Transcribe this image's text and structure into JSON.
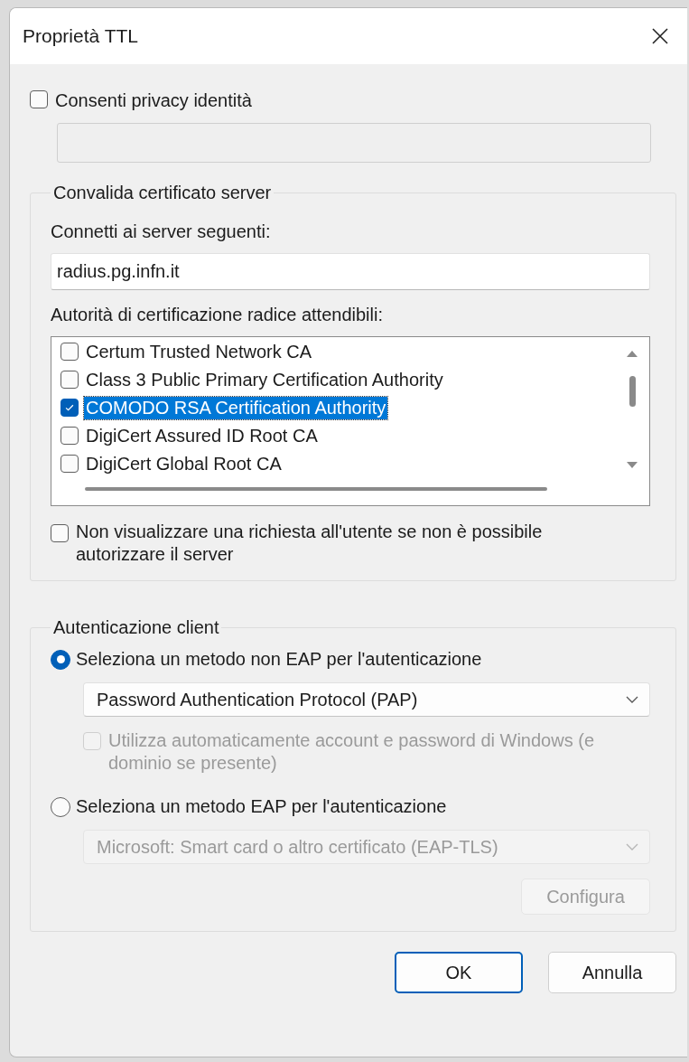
{
  "window": {
    "title": "Proprietà TTL"
  },
  "identity_privacy": {
    "label": "Consenti privacy identità",
    "checked": false,
    "field_disabled": true
  },
  "server_validation": {
    "title": "Convalida certificato server",
    "servers_label": "Connetti ai server seguenti:",
    "servers_value": "radius.pg.infn.it",
    "ca_label": "Autorità di certificazione radice attendibili:",
    "ca_list": [
      {
        "label": "Certum Trusted Network CA",
        "checked": false,
        "selected": false
      },
      {
        "label": "Class 3 Public Primary Certification Authority",
        "checked": false,
        "selected": false
      },
      {
        "label": "COMODO RSA Certification Authority",
        "checked": true,
        "selected": true
      },
      {
        "label": "DigiCert Assured ID Root CA",
        "checked": false,
        "selected": false
      },
      {
        "label": "DigiCert Global Root CA",
        "checked": false,
        "selected": false
      }
    ],
    "no_prompt": {
      "label": "Non visualizzare una richiesta all'utente se non è possibile autorizzare il server",
      "checked": false
    }
  },
  "client_auth": {
    "title": "Autenticazione client",
    "methods": [
      {
        "label": "Seleziona un metodo non EAP per l'autenticazione",
        "selected": true,
        "combo": {
          "value": "Password Authentication Protocol (PAP)",
          "disabled": false
        },
        "option": {
          "label": "Utilizza automaticamente account e password di Windows (e dominio se presente)",
          "checked": false,
          "disabled": true
        }
      },
      {
        "label": "Seleziona un metodo EAP per l'autenticazione",
        "selected": false,
        "combo": {
          "value": "Microsoft: Smart card o altro certificato (EAP-TLS)",
          "disabled": true
        },
        "button": {
          "label": "Configura",
          "disabled": true
        }
      }
    ]
  },
  "buttons": [
    {
      "label": "OK",
      "default": true
    },
    {
      "label": "Annulla",
      "default": false
    }
  ]
}
